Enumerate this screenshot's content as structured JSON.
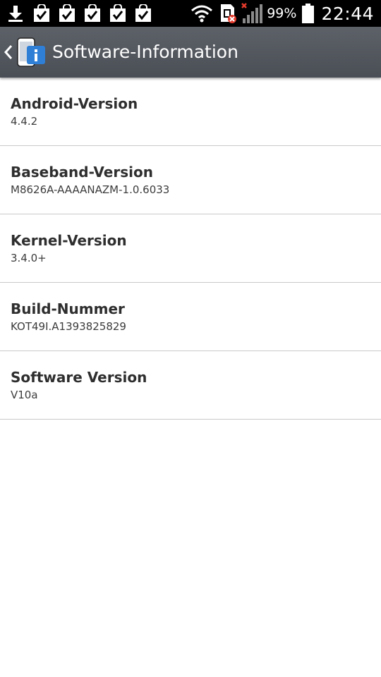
{
  "status_bar": {
    "notification_icons": [
      "download-icon",
      "checkmark-bag-icon",
      "checkmark-bag-icon",
      "checkmark-bag-icon",
      "checkmark-bag-icon",
      "checkmark-bag-icon"
    ],
    "status_icons": [
      "wifi-icon",
      "sim-error-icon",
      "no-signal-icon",
      "battery-icon"
    ],
    "battery_percent": "99%",
    "time": "22:44"
  },
  "action_bar": {
    "back_icon": "chevron-left-icon",
    "app_icon": "info-icon",
    "title": "Software-Information",
    "background_color": "#50545b"
  },
  "info_list": [
    {
      "title": "Android-Version",
      "value": "4.4.2"
    },
    {
      "title": "Baseband-Version",
      "value": "M8626A-AAAANAZM-1.0.6033"
    },
    {
      "title": "Kernel-Version",
      "value": "3.4.0+"
    },
    {
      "title": "Build-Nummer",
      "value": "KOT49I.A1393825829"
    },
    {
      "title": "Software Version",
      "value": "V10a"
    }
  ],
  "colors": {
    "status_bar_bg": "#000000",
    "divider": "#c9c9c9",
    "title_text": "#2e2e2e",
    "value_text": "#3c3c3c",
    "info_icon_blue": "#2f7fd6",
    "sim_error_red": "#e53b2c"
  }
}
